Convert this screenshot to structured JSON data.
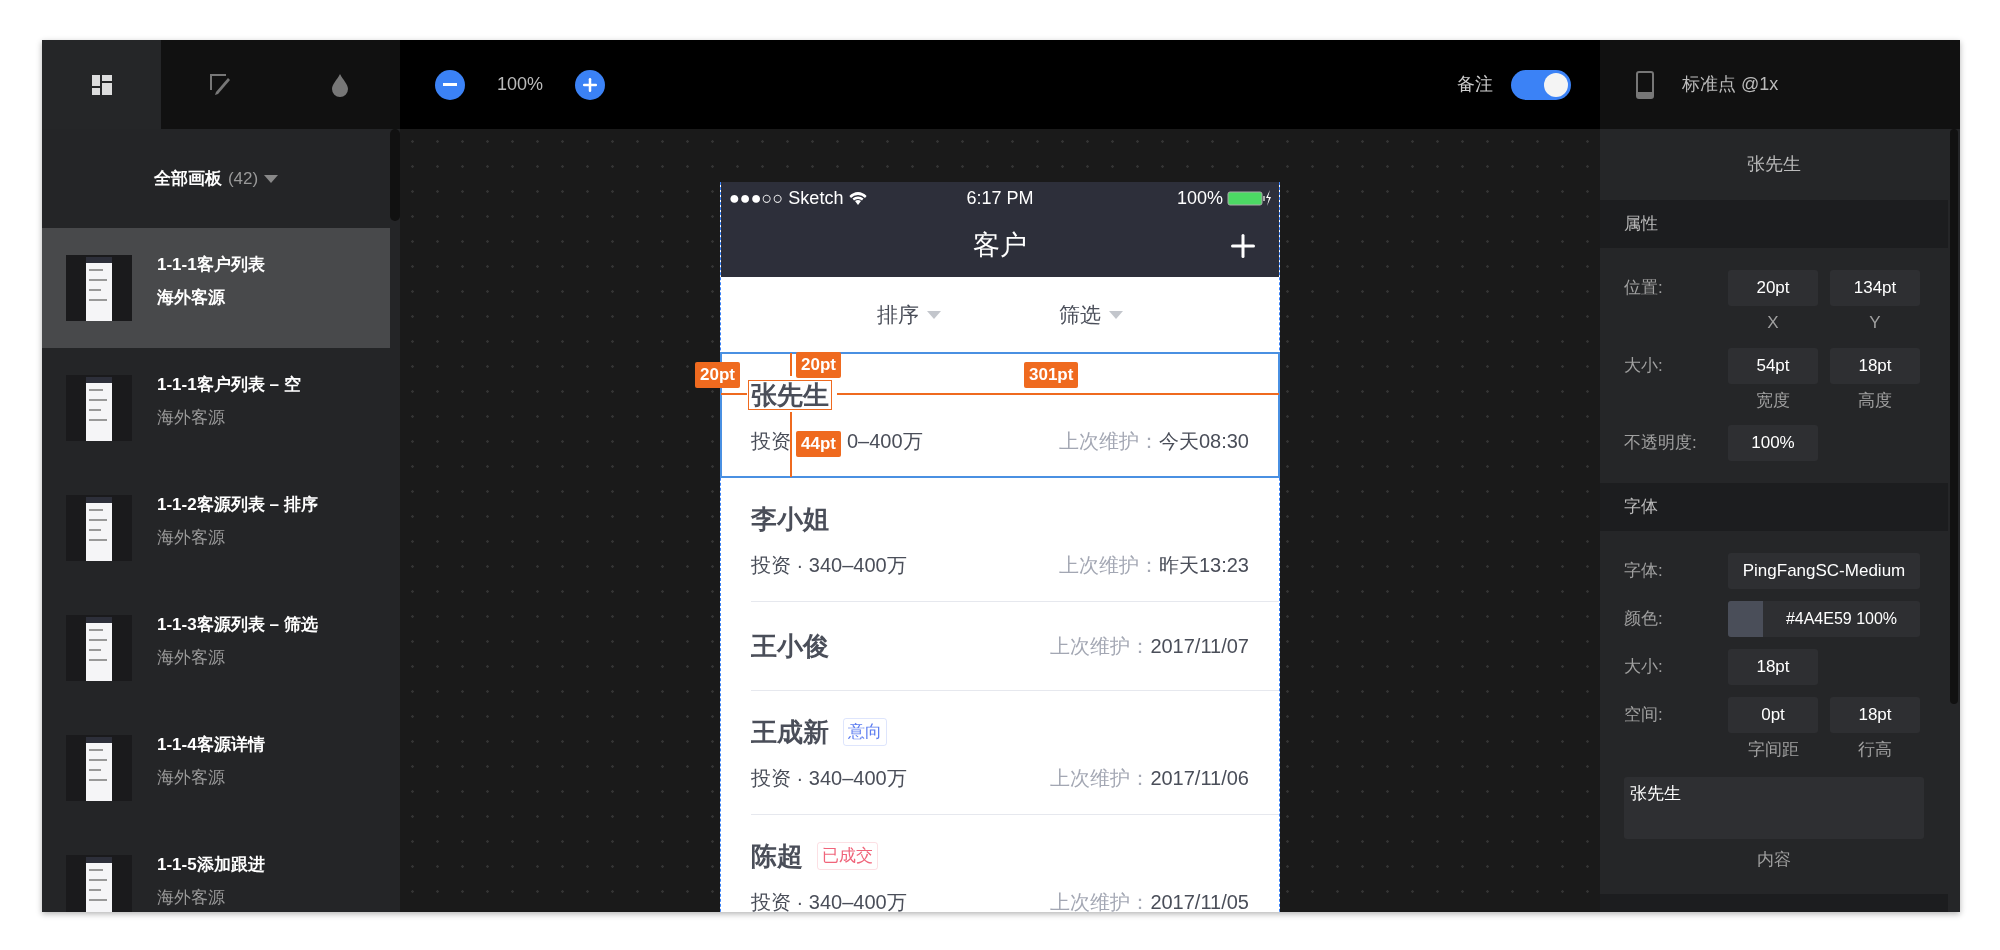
{
  "toolbar": {
    "tabs": [
      {
        "kind": "artboards",
        "selected": true
      },
      {
        "kind": "slices",
        "selected": false
      },
      {
        "kind": "colors",
        "selected": false
      }
    ],
    "zoom": "100%",
    "notes": {
      "label": "备注",
      "on": true
    },
    "device": "标准点 @1x"
  },
  "sidebar": {
    "title": "全部画板",
    "count": "(42)",
    "items": [
      {
        "title": "1-1-1客户列表",
        "subtitle": "海外客源",
        "selected": true
      },
      {
        "title": "1-1-1客户列表 – 空",
        "subtitle": "海外客源",
        "selected": false
      },
      {
        "title": "1-1-2客源列表 – 排序",
        "subtitle": "海外客源",
        "selected": false
      },
      {
        "title": "1-1-3客源列表 – 筛选",
        "subtitle": "海外客源",
        "selected": false
      },
      {
        "title": "1-1-4客源详情",
        "subtitle": "海外客源",
        "selected": false
      },
      {
        "title": "1-1-5添加跟进",
        "subtitle": "海外客源",
        "selected": false
      }
    ]
  },
  "phone": {
    "status": {
      "carrier": "●●●○○ Sketch",
      "time": "6:17 PM",
      "battery": "100%"
    },
    "title": "客户",
    "filters": [
      "排序",
      "筛选"
    ],
    "rows": [
      {
        "name": "张先生",
        "info": [
          "投资",
          "0–400万"
        ],
        "maint_label": "上次维护：",
        "maint_value": "今天08:30",
        "selected": true
      },
      {
        "name": "李小姐",
        "info": [
          "投资 · 340–400万"
        ],
        "maint_label": "上次维护：",
        "maint_value": "昨天13:23",
        "selected": false
      },
      {
        "name": "王小俊",
        "maint_label": "上次维护：",
        "maint_value": "2017/11/07",
        "selected": false
      },
      {
        "name": "王成新",
        "tag": {
          "text": "意向",
          "color": "#5b7cf0"
        },
        "info": [
          "投资 · 340–400万"
        ],
        "maint_label": "上次维护：",
        "maint_value": "2017/11/06",
        "selected": false
      },
      {
        "name": "陈超",
        "tag": {
          "text": "已成交",
          "color": "#f0647a"
        },
        "info": [
          "投资 · 340–400万"
        ],
        "maint_label": "上次维护：",
        "maint_value": "2017/11/05",
        "selected": false
      }
    ],
    "measurements": [
      {
        "kind": "left",
        "text": "20pt"
      },
      {
        "kind": "top",
        "text": "20pt"
      },
      {
        "kind": "right",
        "text": "301pt"
      },
      {
        "kind": "bottom",
        "text": "44pt"
      }
    ]
  },
  "inspector": {
    "title": "张先生",
    "sections": [
      {
        "title": "属性",
        "fields": [
          {
            "kind": "pair",
            "label": "位置:",
            "values": [
              {
                "value": "20pt",
                "caption": "X"
              },
              {
                "value": "134pt",
                "caption": "Y"
              }
            ]
          },
          {
            "kind": "pair",
            "label": "大小:",
            "values": [
              {
                "value": "54pt",
                "caption": "宽度"
              },
              {
                "value": "18pt",
                "caption": "高度"
              }
            ]
          },
          {
            "kind": "pair",
            "label": "不透明度:",
            "values": [
              {
                "value": "100%"
              }
            ]
          }
        ]
      },
      {
        "title": "字体",
        "fields": [
          {
            "kind": "wide",
            "label": "字体:",
            "value": "PingFangSC-Medium"
          },
          {
            "kind": "color",
            "label": "颜色:",
            "color": "#4a4e59",
            "value": "#4A4E59 100%"
          },
          {
            "kind": "pair",
            "label": "大小:",
            "values": [
              {
                "value": "18pt"
              }
            ]
          },
          {
            "kind": "pair",
            "label": "空间:",
            "values": [
              {
                "value": "0pt",
                "caption": "字间距"
              },
              {
                "value": "18pt",
                "caption": "行高"
              }
            ]
          }
        ]
      }
    ],
    "content": {
      "value": "张先生",
      "caption": "内容"
    }
  }
}
